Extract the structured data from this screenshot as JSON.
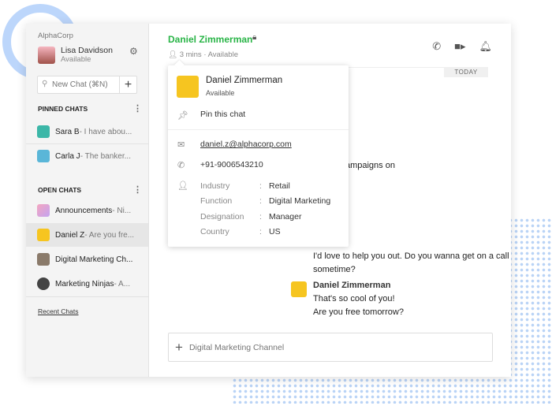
{
  "sidebar": {
    "org": "AlphaCorp",
    "user": {
      "name": "Lisa Davidson",
      "status": "Available"
    },
    "search_placeholder": "New Chat (⌘N)",
    "pinned_title": "PINNED CHATS",
    "pinned": [
      {
        "name": "Sara B",
        "preview": " - I have abou..."
      },
      {
        "name": "Carla J",
        "preview": " - The banker..."
      }
    ],
    "open_title": "OPEN CHATS",
    "open": [
      {
        "name": "Announcements",
        "preview": " - Ni..."
      },
      {
        "name": "Daniel Z",
        "preview": " - Are you fre..."
      },
      {
        "name": "Digital Marketing Ch...",
        "preview": ""
      },
      {
        "name": "Marketing Ninjas",
        "preview": " - A..."
      }
    ],
    "recent": "Recent Chats"
  },
  "header": {
    "title": "Daniel Zimmerman",
    "last_seen": "3 mins",
    "status": "Available"
  },
  "date_divider": "TODAY",
  "messages": {
    "partial": "d ad campaigns on",
    "m1": "I'd love to help you out. Do you wanna get on a call sometime?",
    "sender": "Daniel Zimmerman",
    "m2": "That's so cool of you!",
    "m3": "Are you free tomorrow?"
  },
  "composer_placeholder": "Digital Marketing Channel",
  "popover": {
    "name": "Daniel Zimmerman",
    "status": "Available",
    "pin": "Pin this chat",
    "email": "daniel.z@alphacorp.com",
    "phone": "+91-9006543210",
    "fields": [
      {
        "k": "Industry",
        "v": "Retail"
      },
      {
        "k": "Function",
        "v": "Digital Marketing"
      },
      {
        "k": "Designation",
        "v": "Manager"
      },
      {
        "k": "Country",
        "v": "US"
      }
    ],
    "sep": ":"
  },
  "colors": {
    "accent": "#28b446",
    "sidebar": "#f4f4f4"
  }
}
